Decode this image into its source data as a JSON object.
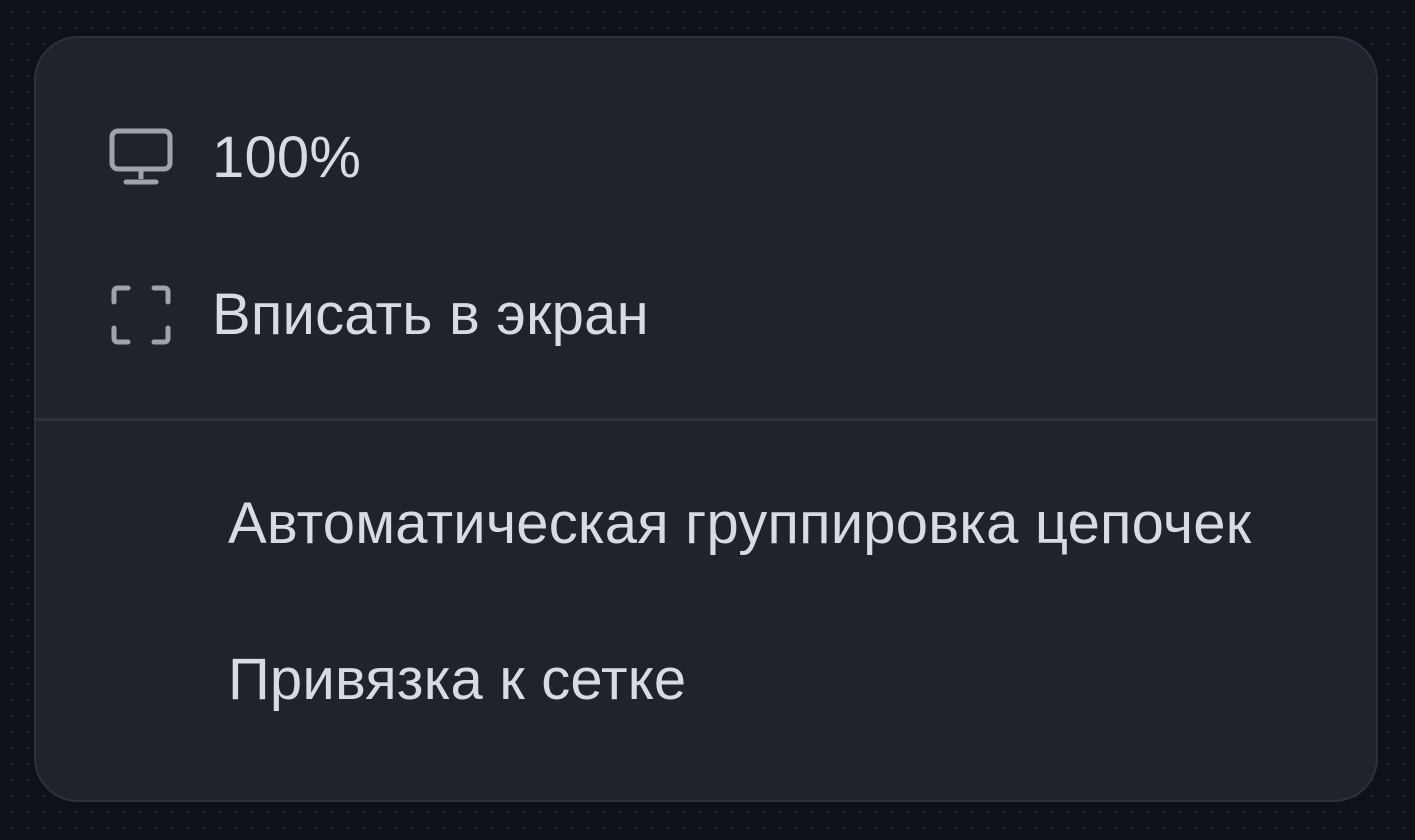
{
  "menu": {
    "items": [
      {
        "label": "100%",
        "icon": "monitor-icon"
      },
      {
        "label": "Вписать в экран",
        "icon": "fit-screen-icon"
      }
    ],
    "toggles": [
      {
        "label": "Автоматическая группировка цепочек"
      },
      {
        "label": "Привязка к сетке"
      }
    ]
  },
  "colors": {
    "background": "#0d1118",
    "menu_background": "#1f232c",
    "menu_border": "#2c313c",
    "text": "#d8dbe3",
    "icon": "#9ea3ad"
  }
}
